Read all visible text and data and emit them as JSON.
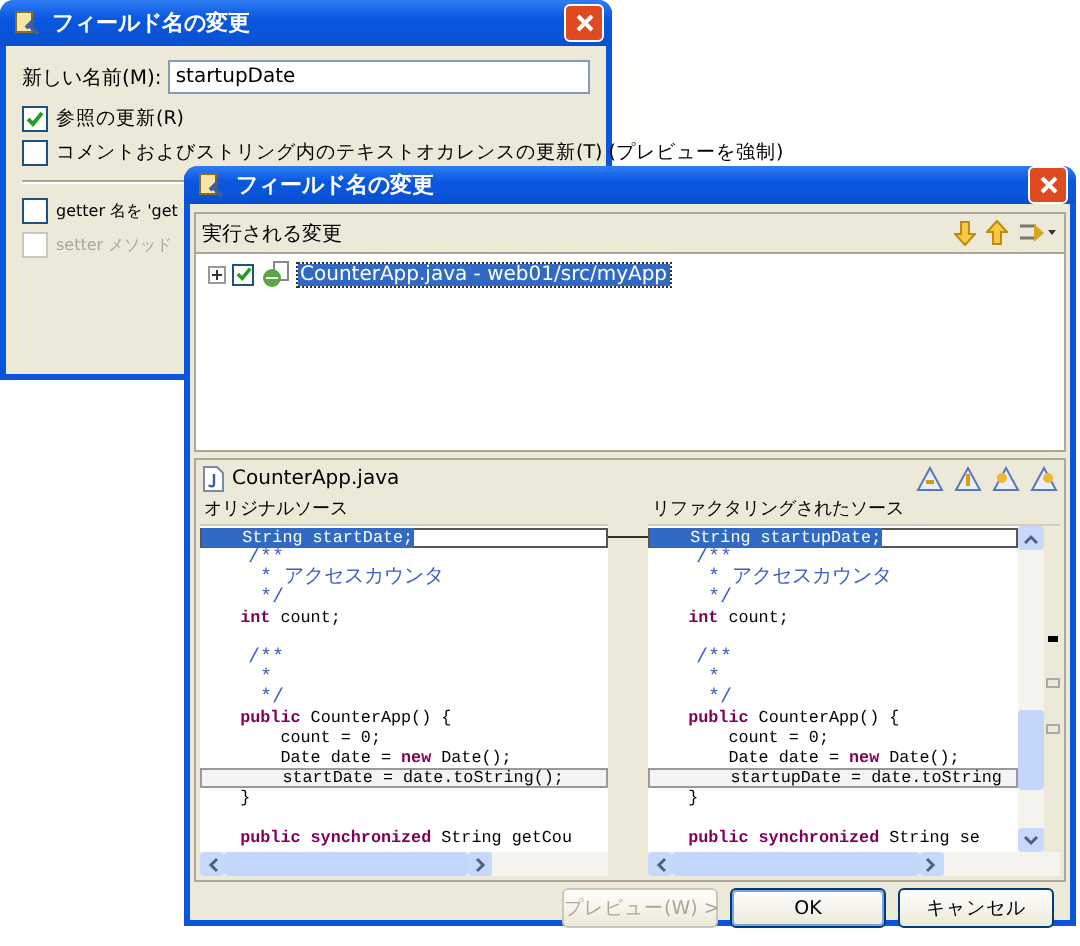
{
  "back_window": {
    "title": "フィールド名の変更",
    "name_label": "新しい名前(M):",
    "name_value": "startupDate",
    "options": [
      {
        "label": "参照の更新(R)",
        "checked": true,
        "disabled": false
      },
      {
        "label": "コメントおよびストリング内のテキストオカレンスの更新(T) (プレビューを強制)",
        "checked": false,
        "disabled": false
      }
    ],
    "accessor_options": [
      {
        "label": "getter 名を 'get",
        "checked": false,
        "disabled": false
      },
      {
        "label": "setter メソッド",
        "checked": false,
        "disabled": true
      }
    ]
  },
  "front_window": {
    "title": "フィールド名の変更",
    "changes": {
      "heading": "実行される変更",
      "items": [
        {
          "label": "CounterApp.java - web01/src/myApp",
          "checked": true,
          "expanded": false,
          "selected": true
        }
      ]
    },
    "compare": {
      "file": "CounterApp.java",
      "left": {
        "heading": "オリジナルソース",
        "lines": [
          {
            "kind": "code",
            "selected": true,
            "changed": false,
            "segments": [
              {
                "text": "    String startDate;",
                "kind": "plain"
              }
            ]
          },
          {
            "kind": "code",
            "selected": false,
            "changed": false,
            "segments": [
              {
                "text": "    /**",
                "kind": "comment"
              }
            ]
          },
          {
            "kind": "code",
            "selected": false,
            "changed": false,
            "segments": [
              {
                "text": "     * アクセスカウンタ",
                "kind": "comment"
              }
            ]
          },
          {
            "kind": "code",
            "selected": false,
            "changed": false,
            "segments": [
              {
                "text": "     */",
                "kind": "comment"
              }
            ]
          },
          {
            "kind": "code",
            "selected": false,
            "changed": false,
            "segments": [
              {
                "text": "    int",
                "kind": "keyword"
              },
              {
                "text": " count;",
                "kind": "plain"
              }
            ]
          },
          {
            "kind": "blank",
            "selected": false,
            "changed": false
          },
          {
            "kind": "code",
            "selected": false,
            "changed": false,
            "segments": [
              {
                "text": "    /**",
                "kind": "comment"
              }
            ]
          },
          {
            "kind": "code",
            "selected": false,
            "changed": false,
            "segments": [
              {
                "text": "     *",
                "kind": "comment"
              }
            ]
          },
          {
            "kind": "code",
            "selected": false,
            "changed": false,
            "segments": [
              {
                "text": "     */",
                "kind": "comment"
              }
            ]
          },
          {
            "kind": "code",
            "selected": false,
            "changed": false,
            "segments": [
              {
                "text": "    public",
                "kind": "keyword"
              },
              {
                "text": " CounterApp() {",
                "kind": "plain"
              }
            ]
          },
          {
            "kind": "code",
            "selected": false,
            "changed": false,
            "segments": [
              {
                "text": "        count = 0;",
                "kind": "plain"
              }
            ]
          },
          {
            "kind": "code",
            "selected": false,
            "changed": false,
            "segments": [
              {
                "text": "        Date date = ",
                "kind": "plain"
              },
              {
                "text": "new",
                "kind": "keyword"
              },
              {
                "text": " Date();",
                "kind": "plain"
              }
            ]
          },
          {
            "kind": "code",
            "selected": false,
            "changed": true,
            "segments": [
              {
                "text": "        startDate = date.toString();",
                "kind": "plain"
              }
            ]
          },
          {
            "kind": "code",
            "selected": false,
            "changed": false,
            "segments": [
              {
                "text": "    }",
                "kind": "plain"
              }
            ]
          },
          {
            "kind": "blank",
            "selected": false,
            "changed": false
          },
          {
            "kind": "code",
            "selected": false,
            "changed": false,
            "segments": [
              {
                "text": "    public synchronized",
                "kind": "keyword"
              },
              {
                "text": " String getCou",
                "kind": "plain"
              }
            ]
          }
        ]
      },
      "right": {
        "heading": "リファクタリングされたソース",
        "lines": [
          {
            "kind": "code",
            "selected": true,
            "changed": false,
            "segments": [
              {
                "text": "    String startupDate;",
                "kind": "plain"
              }
            ]
          },
          {
            "kind": "code",
            "selected": false,
            "changed": false,
            "segments": [
              {
                "text": "    /**",
                "kind": "comment"
              }
            ]
          },
          {
            "kind": "code",
            "selected": false,
            "changed": false,
            "segments": [
              {
                "text": "     * アクセスカウンタ",
                "kind": "comment"
              }
            ]
          },
          {
            "kind": "code",
            "selected": false,
            "changed": false,
            "segments": [
              {
                "text": "     */",
                "kind": "comment"
              }
            ]
          },
          {
            "kind": "code",
            "selected": false,
            "changed": false,
            "segments": [
              {
                "text": "    int",
                "kind": "keyword"
              },
              {
                "text": " count;",
                "kind": "plain"
              }
            ]
          },
          {
            "kind": "blank",
            "selected": false,
            "changed": false
          },
          {
            "kind": "code",
            "selected": false,
            "changed": false,
            "segments": [
              {
                "text": "    /**",
                "kind": "comment"
              }
            ]
          },
          {
            "kind": "code",
            "selected": false,
            "changed": false,
            "segments": [
              {
                "text": "     *",
                "kind": "comment"
              }
            ]
          },
          {
            "kind": "code",
            "selected": false,
            "changed": false,
            "segments": [
              {
                "text": "     */",
                "kind": "comment"
              }
            ]
          },
          {
            "kind": "code",
            "selected": false,
            "changed": false,
            "segments": [
              {
                "text": "    public",
                "kind": "keyword"
              },
              {
                "text": " CounterApp() {",
                "kind": "plain"
              }
            ]
          },
          {
            "kind": "code",
            "selected": false,
            "changed": false,
            "segments": [
              {
                "text": "        count = 0;",
                "kind": "plain"
              }
            ]
          },
          {
            "kind": "code",
            "selected": false,
            "changed": false,
            "segments": [
              {
                "text": "        Date date = ",
                "kind": "plain"
              },
              {
                "text": "new",
                "kind": "keyword"
              },
              {
                "text": " Date();",
                "kind": "plain"
              }
            ]
          },
          {
            "kind": "code",
            "selected": false,
            "changed": true,
            "segments": [
              {
                "text": "        startupDate = date.toString",
                "kind": "plain"
              }
            ]
          },
          {
            "kind": "code",
            "selected": false,
            "changed": false,
            "segments": [
              {
                "text": "    }",
                "kind": "plain"
              }
            ]
          },
          {
            "kind": "blank",
            "selected": false,
            "changed": false
          },
          {
            "kind": "code",
            "selected": false,
            "changed": false,
            "segments": [
              {
                "text": "    public synchronized",
                "kind": "keyword"
              },
              {
                "text": " String se",
                "kind": "plain"
              }
            ]
          }
        ]
      }
    },
    "buttons": [
      {
        "label": "プレビュー(W) >",
        "disabled": true,
        "default": false
      },
      {
        "label": "OK",
        "disabled": false,
        "default": true
      },
      {
        "label": "キャンセル",
        "disabled": false,
        "default": false
      }
    ]
  }
}
